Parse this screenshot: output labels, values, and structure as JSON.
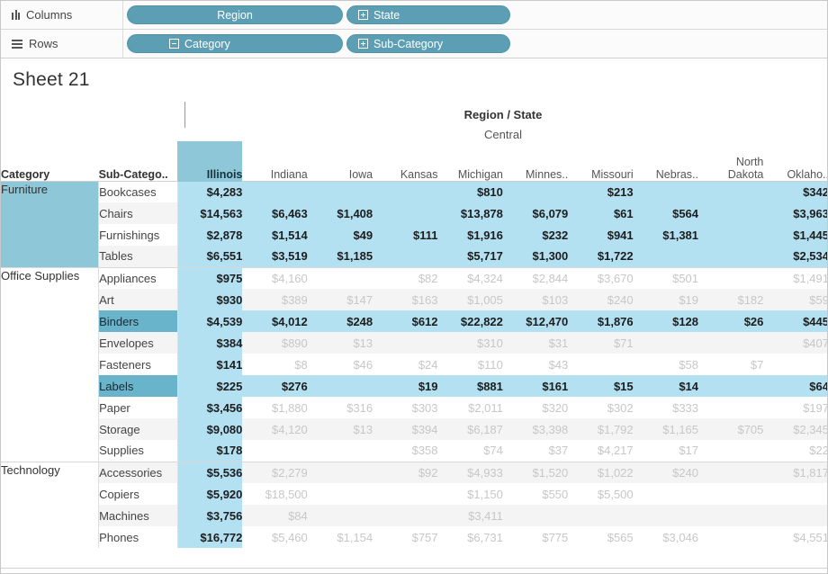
{
  "shelves": {
    "columns": {
      "label": "Columns",
      "icon": "columns-icon",
      "pills": [
        {
          "label": "Region",
          "expander": "none"
        },
        {
          "label": "State",
          "expander": "plus"
        }
      ]
    },
    "rows": {
      "label": "Rows",
      "icon": "rows-icon",
      "pills": [
        {
          "label": "Category",
          "expander": "minus"
        },
        {
          "label": "Sub-Category",
          "expander": "plus"
        }
      ]
    }
  },
  "worksheet": {
    "title": "Sheet 21",
    "column_field_title": "Region / State",
    "region": "Central",
    "row_header_labels": {
      "category": "Category",
      "subcategory": "Sub-Catego.."
    }
  },
  "chart_data": {
    "type": "table",
    "title": "Sheet 21",
    "column_field_title": "Region / State",
    "region": "Central",
    "xlabel": "Region / State",
    "ylabel": "Category / Sub-Category",
    "states": [
      "Illinois",
      "Indiana",
      "Iowa",
      "Kansas",
      "Michigan",
      "Minnes..",
      "Missouri",
      "Nebras..",
      "North Dakota",
      "Oklaho.."
    ],
    "selected_state": "Illinois",
    "selected_category": "Furniture",
    "selected_subcategories": [
      "Binders",
      "Labels"
    ],
    "colors": {
      "highlight": "#b4e1f2",
      "header_selected": "#8dc7d8",
      "pill": "#5c9fb5",
      "dim_text": "#c7c7c7"
    },
    "rows": [
      {
        "category": "Furniture",
        "subcategory": "Bookcases",
        "values": [
          "$4,283",
          "",
          "",
          "",
          "$810",
          "",
          "$213",
          "",
          "",
          "$342"
        ],
        "highlighted": true
      },
      {
        "category": "Furniture",
        "subcategory": "Chairs",
        "values": [
          "$14,563",
          "$6,463",
          "$1,408",
          "",
          "$13,878",
          "$6,079",
          "$61",
          "$564",
          "",
          "$3,963"
        ],
        "highlighted": true
      },
      {
        "category": "Furniture",
        "subcategory": "Furnishings",
        "values": [
          "$2,878",
          "$1,514",
          "$49",
          "$111",
          "$1,916",
          "$232",
          "$941",
          "$1,381",
          "",
          "$1,445"
        ],
        "highlighted": true
      },
      {
        "category": "Furniture",
        "subcategory": "Tables",
        "values": [
          "$6,551",
          "$3,519",
          "$1,185",
          "",
          "$5,717",
          "$1,300",
          "$1,722",
          "",
          "",
          "$2,534"
        ],
        "highlighted": true
      },
      {
        "category": "Office Supplies",
        "subcategory": "Appliances",
        "values": [
          "$975",
          "$4,160",
          "",
          "$82",
          "$4,324",
          "$2,844",
          "$3,670",
          "$501",
          "",
          "$1,491"
        ],
        "highlighted": false
      },
      {
        "category": "Office Supplies",
        "subcategory": "Art",
        "values": [
          "$930",
          "$389",
          "$147",
          "$163",
          "$1,005",
          "$103",
          "$240",
          "$19",
          "$182",
          "$59"
        ],
        "highlighted": false
      },
      {
        "category": "Office Supplies",
        "subcategory": "Binders",
        "values": [
          "$4,539",
          "$4,012",
          "$248",
          "$612",
          "$22,822",
          "$12,470",
          "$1,876",
          "$128",
          "$26",
          "$445"
        ],
        "highlighted": true
      },
      {
        "category": "Office Supplies",
        "subcategory": "Envelopes",
        "values": [
          "$384",
          "$890",
          "$13",
          "",
          "$310",
          "$31",
          "$71",
          "",
          "",
          "$407"
        ],
        "highlighted": false
      },
      {
        "category": "Office Supplies",
        "subcategory": "Fasteners",
        "values": [
          "$141",
          "$8",
          "$46",
          "$24",
          "$110",
          "$43",
          "",
          "$58",
          "$7",
          ""
        ],
        "highlighted": false
      },
      {
        "category": "Office Supplies",
        "subcategory": "Labels",
        "values": [
          "$225",
          "$276",
          "",
          "$19",
          "$881",
          "$161",
          "$15",
          "$14",
          "",
          "$64"
        ],
        "highlighted": true
      },
      {
        "category": "Office Supplies",
        "subcategory": "Paper",
        "values": [
          "$3,456",
          "$1,880",
          "$316",
          "$303",
          "$2,011",
          "$320",
          "$302",
          "$333",
          "",
          "$197"
        ],
        "highlighted": false
      },
      {
        "category": "Office Supplies",
        "subcategory": "Storage",
        "values": [
          "$9,080",
          "$4,120",
          "$13",
          "$394",
          "$6,187",
          "$3,398",
          "$1,792",
          "$1,165",
          "$705",
          "$2,345"
        ],
        "highlighted": false
      },
      {
        "category": "Office Supplies",
        "subcategory": "Supplies",
        "values": [
          "$178",
          "",
          "",
          "$358",
          "$74",
          "$37",
          "$4,217",
          "$17",
          "",
          "$22"
        ],
        "highlighted": false
      },
      {
        "category": "Technology",
        "subcategory": "Accessories",
        "values": [
          "$5,536",
          "$2,279",
          "",
          "$92",
          "$4,933",
          "$1,520",
          "$1,022",
          "$240",
          "",
          "$1,817"
        ],
        "highlighted": false
      },
      {
        "category": "Technology",
        "subcategory": "Copiers",
        "values": [
          "$5,920",
          "$18,500",
          "",
          "",
          "$1,150",
          "$550",
          "$5,500",
          "",
          "",
          ""
        ],
        "highlighted": false
      },
      {
        "category": "Technology",
        "subcategory": "Machines",
        "values": [
          "$3,756",
          "$84",
          "",
          "",
          "$3,411",
          "",
          "",
          "",
          "",
          ""
        ],
        "highlighted": false
      },
      {
        "category": "Technology",
        "subcategory": "Phones",
        "values": [
          "$16,772",
          "$5,460",
          "$1,154",
          "$757",
          "$6,731",
          "$775",
          "$565",
          "$3,046",
          "",
          "$4,551"
        ],
        "highlighted": false
      }
    ]
  }
}
